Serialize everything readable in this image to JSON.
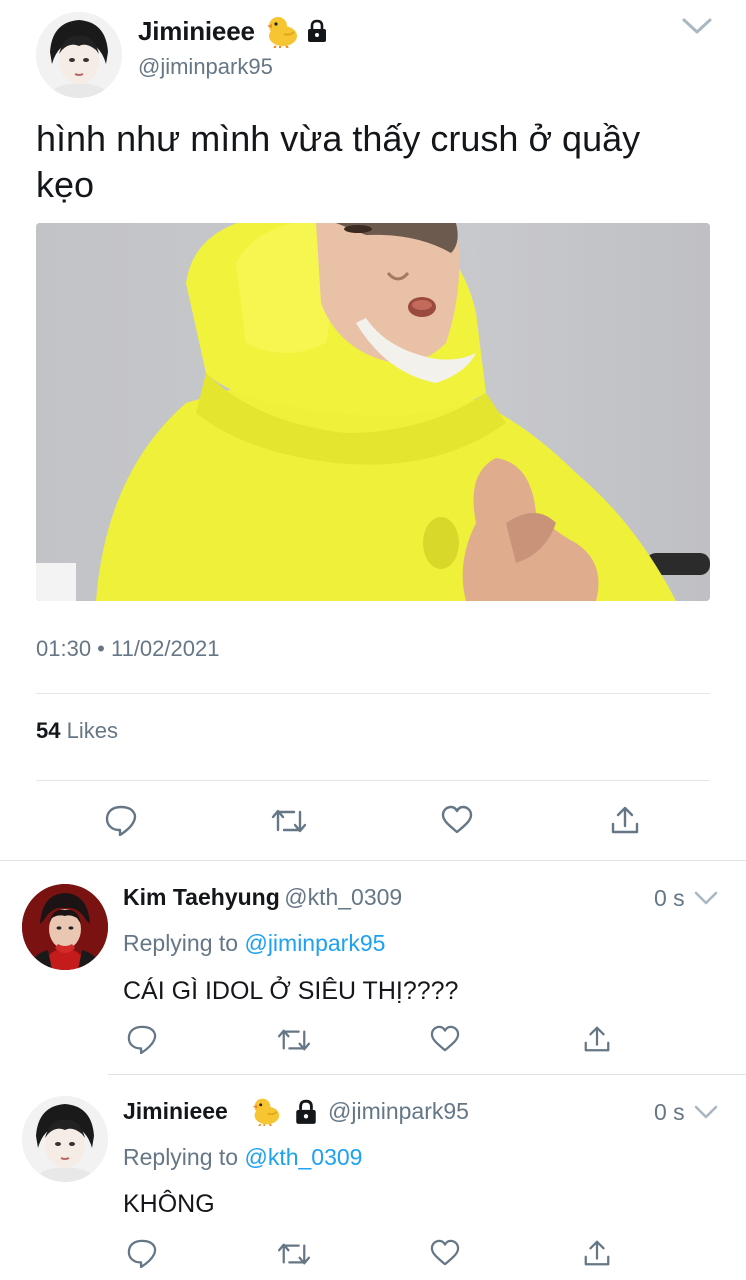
{
  "main_tweet": {
    "display_name": "Jiminieee",
    "name_emoji": "baby-chick-emoji",
    "handle": "@jiminpark95",
    "text": "hình như mình vừa thấy crush ở quầy kẹo",
    "timestamp": "01:30 • 11/02/2021",
    "likes_count": "54",
    "likes_label": "Likes",
    "protected": true
  },
  "replies": [
    {
      "display_name": "Kim Taehyung",
      "handle": "@kth_0309",
      "time": "0 s",
      "replying_prefix": "Replying to",
      "replying_to": "@jiminpark95",
      "text": "CÁI GÌ IDOL Ở SIÊU THỊ????"
    },
    {
      "display_name": "Jiminieee",
      "name_emoji": "baby-chick-emoji",
      "handle": "@jiminpark95",
      "time": "0 s",
      "replying_prefix": "Replying to",
      "replying_to": "@kth_0309",
      "text": "KHÔNG",
      "protected": true
    }
  ],
  "colors": {
    "text": "#14171a",
    "muted": "#657786",
    "link": "#1da1f2",
    "divider": "#e1e8ed",
    "hoodie": "#f2f23a"
  },
  "icons": [
    "reply-icon",
    "retweet-icon",
    "like-icon",
    "share-icon",
    "lock-icon",
    "chevron-down-icon"
  ]
}
